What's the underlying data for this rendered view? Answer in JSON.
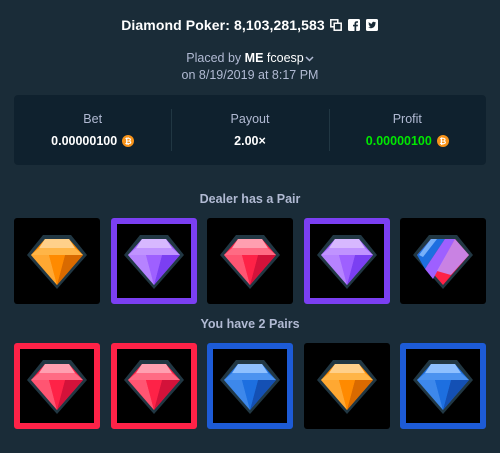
{
  "header": {
    "title": "Diamond Poker: 8,103,281,583",
    "copy_icon": "copy-icon",
    "facebook_icon": "facebook-icon",
    "twitter_icon": "twitter-icon"
  },
  "placed": {
    "prefix": "Placed by",
    "user": "ME",
    "handle": "fcoesp",
    "datetime": "on 8/19/2019 at 8:17 PM"
  },
  "stats": {
    "bet": {
      "label": "Bet",
      "value": "0.00000100"
    },
    "payout": {
      "label": "Payout",
      "value": "2.00×"
    },
    "profit": {
      "label": "Profit",
      "value": "0.00000100"
    },
    "currency_icon": "bitcoin-icon",
    "currency_glyph": "₿"
  },
  "dealer": {
    "title": "Dealer has a Pair",
    "gems": [
      {
        "name": "orange",
        "highlight": false
      },
      {
        "name": "purple",
        "highlight": true
      },
      {
        "name": "red",
        "highlight": false
      },
      {
        "name": "purple",
        "highlight": true
      },
      {
        "name": "split",
        "highlight": false
      }
    ]
  },
  "player": {
    "title": "You have 2 Pairs",
    "gems": [
      {
        "name": "red",
        "highlight": true
      },
      {
        "name": "red",
        "highlight": true
      },
      {
        "name": "blue",
        "highlight": true
      },
      {
        "name": "orange",
        "highlight": false
      },
      {
        "name": "blue",
        "highlight": true
      }
    ]
  },
  "colors": {
    "background": "#1a2c38",
    "panel": "#0f212e",
    "profit": "#00e701",
    "purple_highlight": "#7b3ff2",
    "red_highlight": "#fe2247",
    "blue_highlight": "#1d5bd6"
  }
}
